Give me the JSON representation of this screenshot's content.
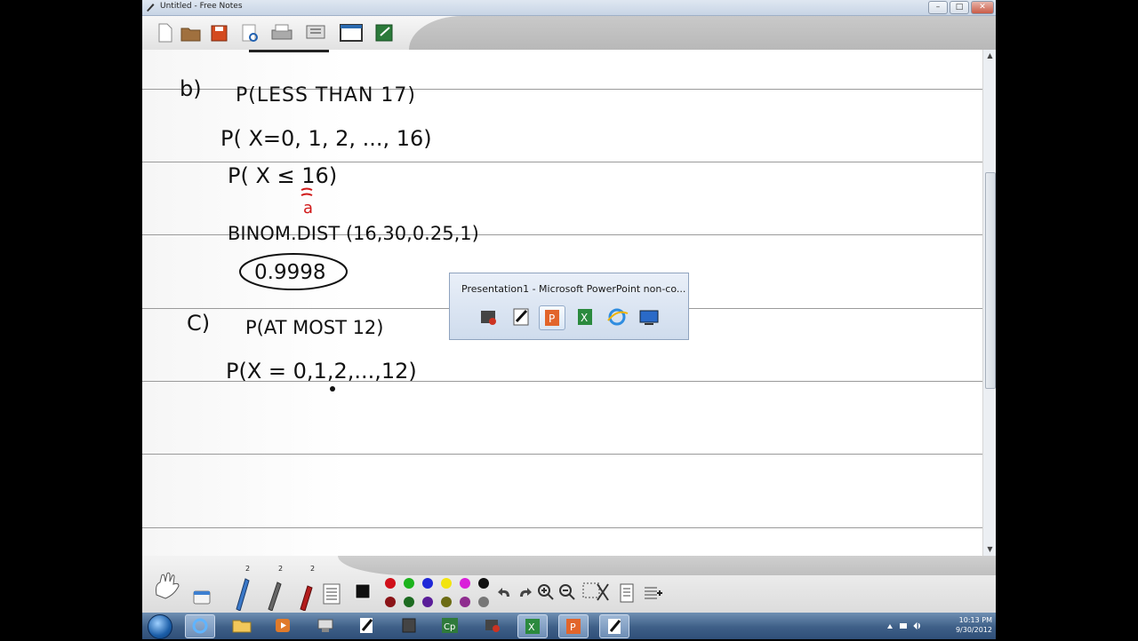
{
  "window": {
    "title": "Untitled - Free Notes",
    "buttons": [
      "–",
      "□",
      "✕"
    ]
  },
  "toolbar": {
    "icons": [
      "new-document-icon",
      "open-folder-icon",
      "save-icon",
      "print-preview-icon",
      "print-icon",
      "page-setup-icon",
      "window-icon",
      "exit-icon"
    ]
  },
  "note": {
    "b_label": "b)",
    "b_line1": "P(LESS THAN 17)",
    "b_line2": "P( X=0, 1, 2, ..., 16)",
    "b_line3": "P( X ≤ 16)",
    "b_line3_annot": "a",
    "b_line4": "BINOM.DIST (16,30,0.25,1)",
    "b_answer": "0.9998",
    "c_label": "C)",
    "c_line1": "P(AT MOST 12)",
    "c_line2": "P(X = 0,1,2,...,12)"
  },
  "pen_toolbar": {
    "sizes": [
      "2",
      "2",
      "2"
    ],
    "colors_top": [
      "#d0101a",
      "#1db31d",
      "#1f28d8",
      "#f2e40f",
      "#d91fd9",
      "#111111"
    ],
    "colors_bottom": [
      "#8b1418",
      "#1d6b21",
      "#5a1d99",
      "#6b6b14",
      "#8f2d8f",
      "#777777"
    ]
  },
  "taskbar_popup": {
    "title": "Presentation1 - Microsoft PowerPoint non-co..."
  },
  "taskbar": {
    "time": "10:13 PM",
    "date": "9/30/2012"
  }
}
